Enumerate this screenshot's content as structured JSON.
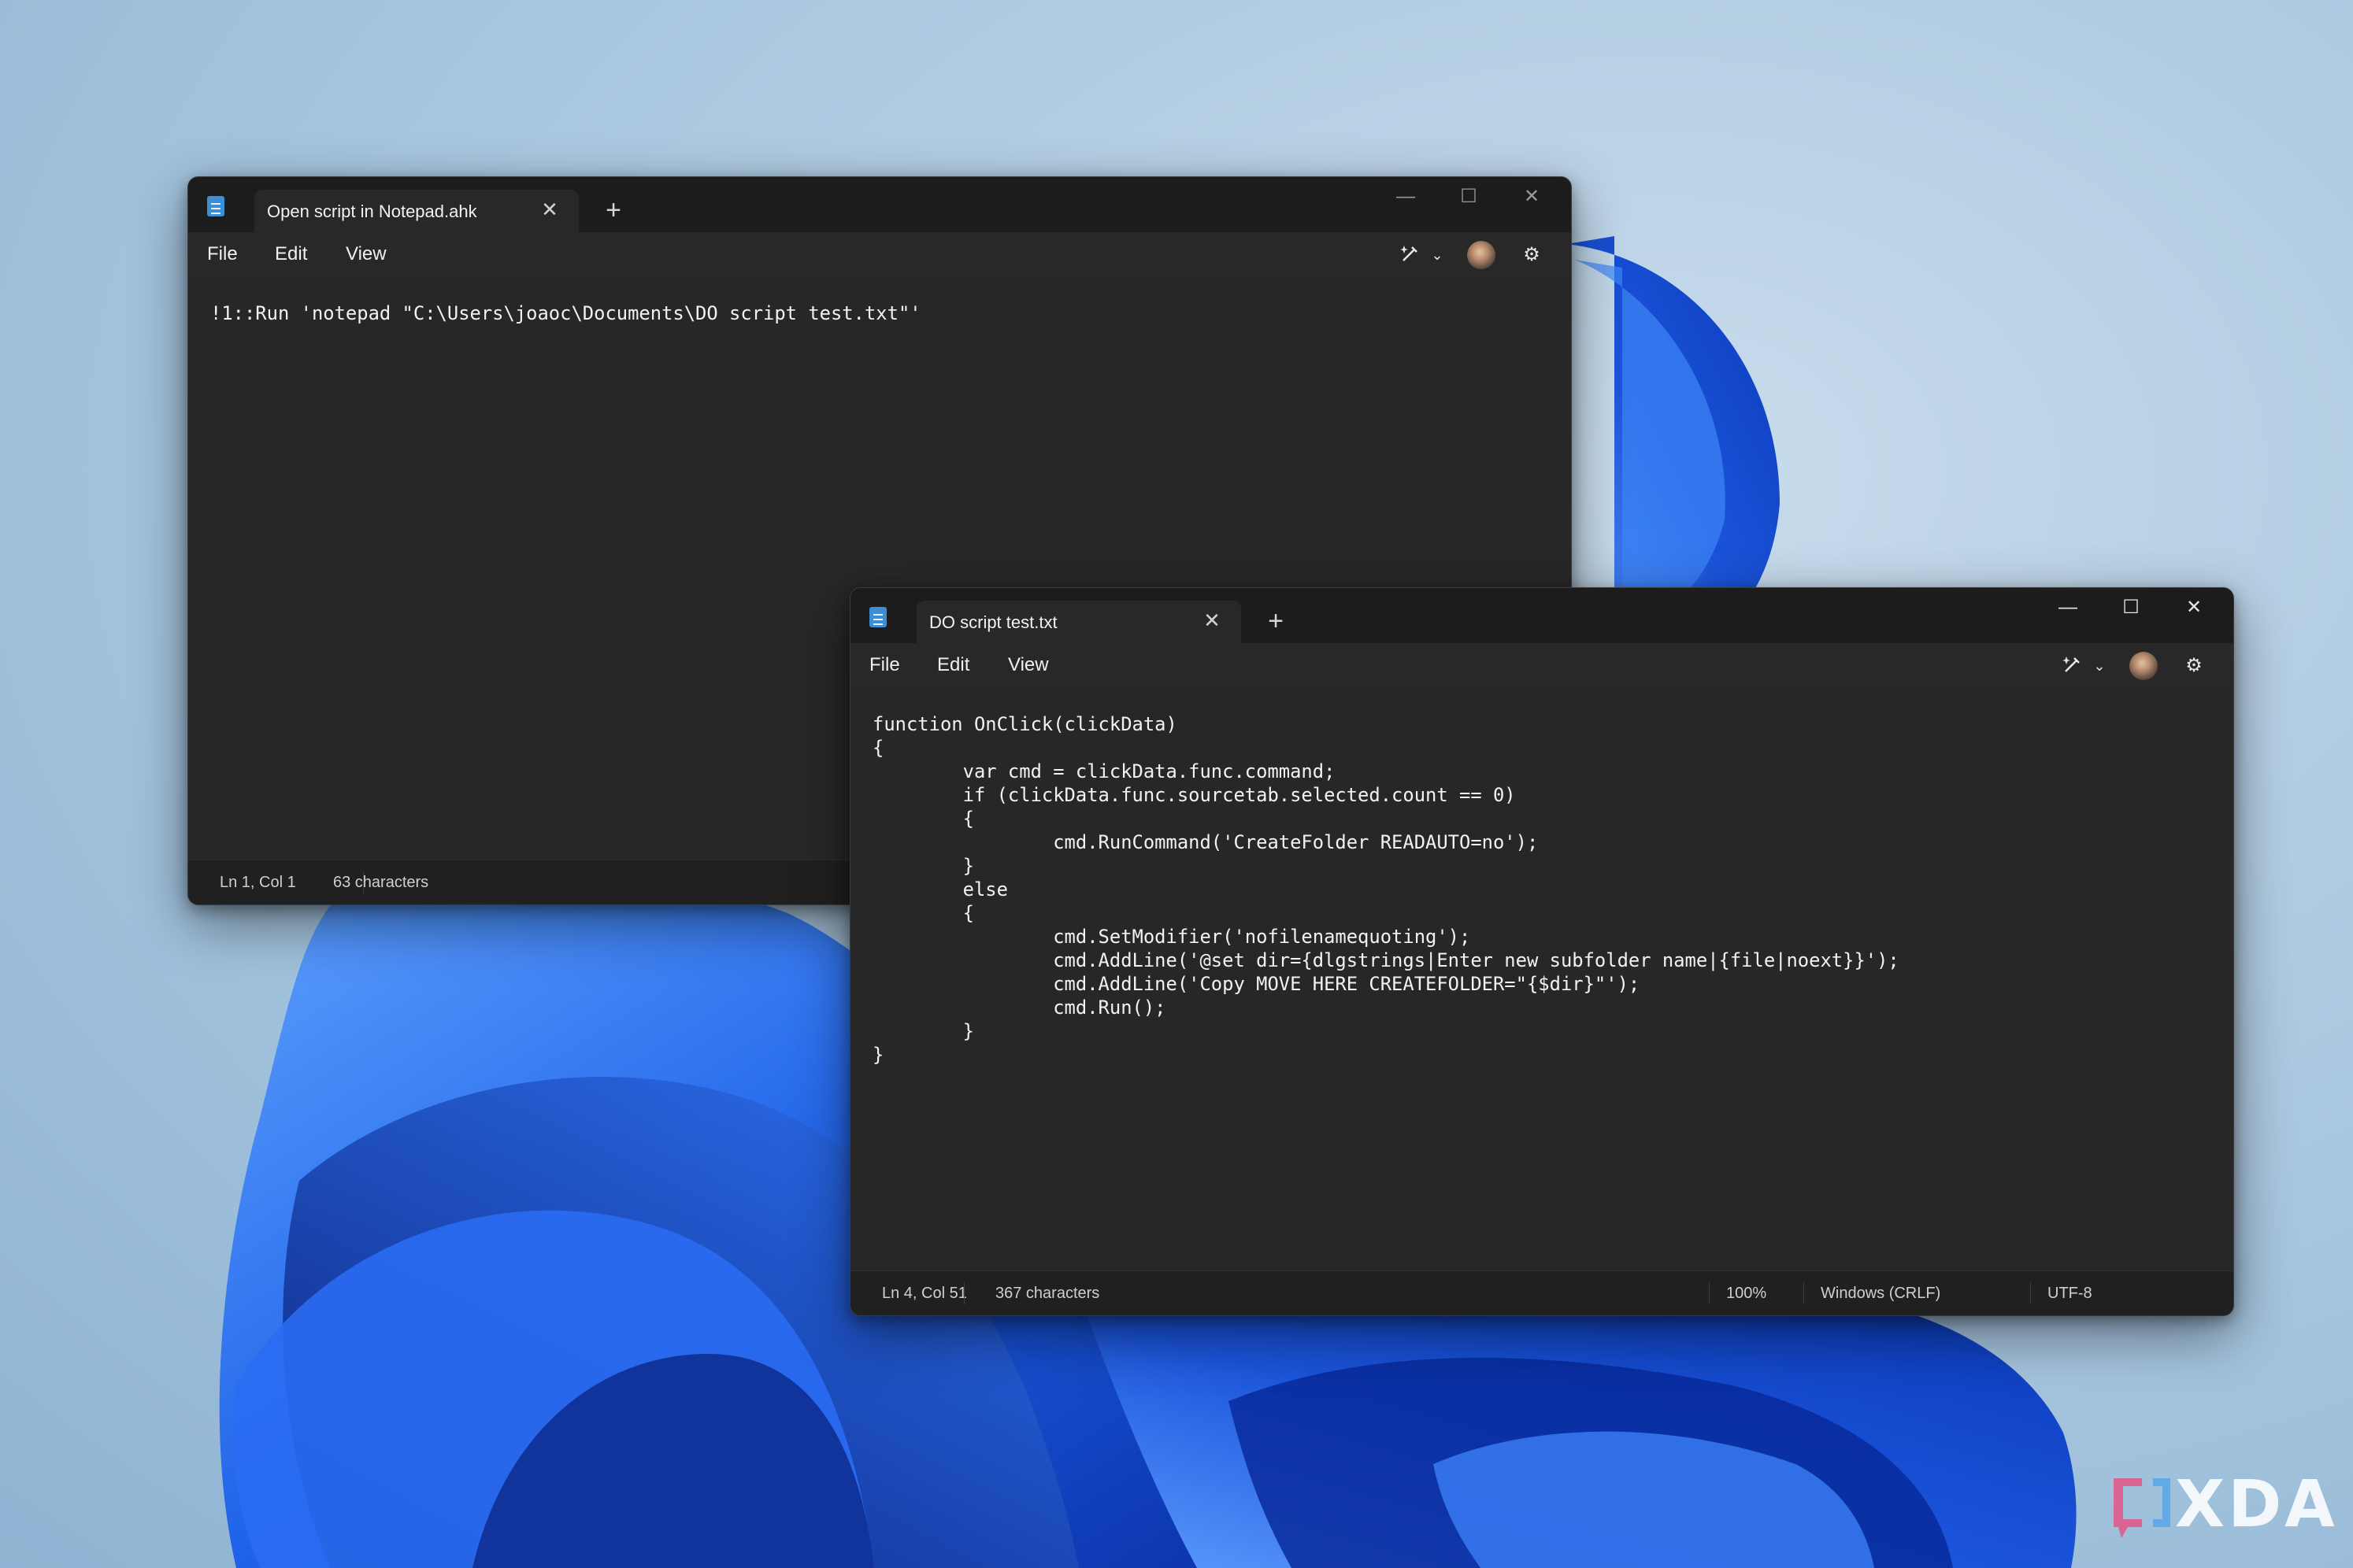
{
  "colors": {
    "window_bg": "#202020",
    "titlebar_bg": "#1c1c1c",
    "editor_bg": "#272727",
    "text": "#f2f2f2",
    "wallpaper_blue": "#1a5ce6"
  },
  "back_window": {
    "tab_title": "Open script in Notepad.ahk",
    "tab_close_icon": "✕",
    "new_tab_icon": "+",
    "controls": {
      "minimize": "—",
      "maximize": "☐",
      "close": "✕"
    },
    "menu": {
      "file": "File",
      "edit": "Edit",
      "view": "View"
    },
    "toolbar_icons": [
      "copilot-icon",
      "chevron-down-icon",
      "avatar",
      "gear-icon"
    ],
    "lines": [
      "!1::Run 'notepad \"C:\\Users\\joaoc\\Documents\\DO script test.txt\"'"
    ],
    "status": {
      "position": "Ln 1, Col 1",
      "characters": "63 characters"
    }
  },
  "front_window": {
    "tab_title": "DO script test.txt",
    "tab_close_icon": "✕",
    "new_tab_icon": "+",
    "controls": {
      "minimize": "—",
      "maximize": "☐",
      "close": "✕"
    },
    "menu": {
      "file": "File",
      "edit": "Edit",
      "view": "View"
    },
    "toolbar_icons": [
      "copilot-icon",
      "chevron-down-icon",
      "avatar",
      "gear-icon"
    ],
    "lines": [
      "function OnClick(clickData)",
      "{",
      "        var cmd = clickData.func.command;",
      "        if (clickData.func.sourcetab.selected.count == 0)",
      "        {",
      "                cmd.RunCommand('CreateFolder READAUTO=no');",
      "        }",
      "        else",
      "        {",
      "                cmd.SetModifier('nofilenamequoting');",
      "                cmd.AddLine('@set dir={dlgstrings|Enter new subfolder name|{file|noext}}');",
      "                cmd.AddLine('Copy MOVE HERE CREATEFOLDER=\"{$dir}\"');",
      "                cmd.Run();",
      "        }",
      "}"
    ],
    "status": {
      "position": "Ln 4, Col 51",
      "characters": "367 characters",
      "zoom": "100%",
      "line_ending": "Windows (CRLF)",
      "encoding": "UTF-8"
    }
  },
  "watermark": {
    "text": "XDA"
  }
}
